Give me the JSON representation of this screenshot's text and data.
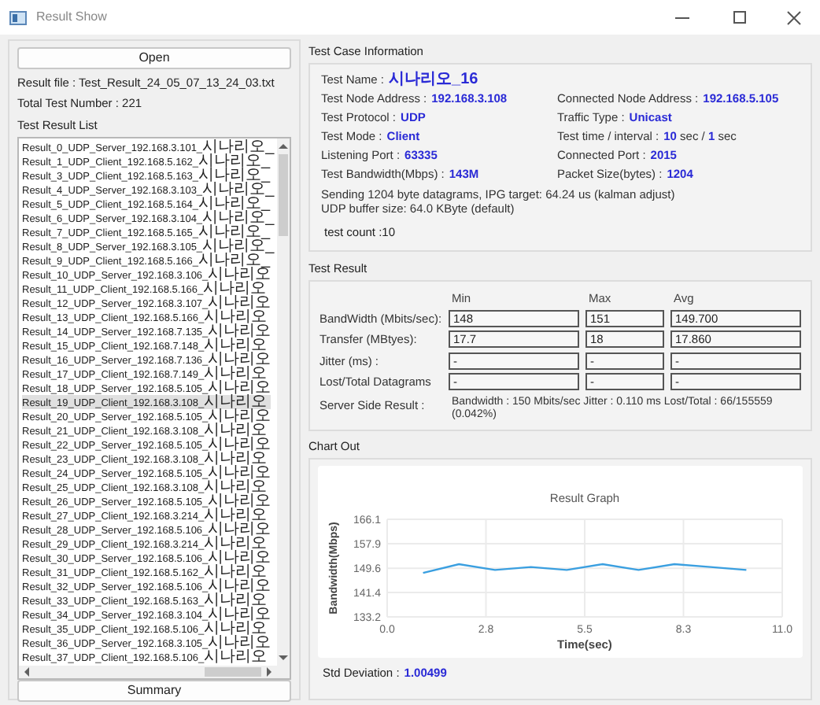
{
  "window": {
    "title": "Result Show"
  },
  "left_panel": {
    "open_button": "Open",
    "result_file": "Result file : Test_Result_24_05_07_13_24_03.txt",
    "total": "Total Test Number : 221",
    "list_title": "Test Result List",
    "items": [
      {
        "text": "Result_0_UDP_Server_192.168.3.101_시나리오_",
        "selected": false
      },
      {
        "text": "Result_1_UDP_Client_192.168.5.162_시나리오_",
        "selected": false
      },
      {
        "text": "Result_3_UDP_Client_192.168.5.163_시나리오_",
        "selected": false
      },
      {
        "text": "Result_4_UDP_Server_192.168.3.103_시나리오_",
        "selected": false
      },
      {
        "text": "Result_5_UDP_Client_192.168.5.164_시나리오_",
        "selected": false
      },
      {
        "text": "Result_6_UDP_Server_192.168.3.104_시나리오_",
        "selected": false
      },
      {
        "text": "Result_7_UDP_Client_192.168.5.165_시나리오_",
        "selected": false
      },
      {
        "text": "Result_8_UDP_Server_192.168.3.105_시나리오_",
        "selected": false
      },
      {
        "text": "Result_9_UDP_Client_192.168.5.166_시나리오_",
        "selected": false
      },
      {
        "text": "Result_10_UDP_Server_192.168.3.106_시나리오",
        "selected": false
      },
      {
        "text": "Result_11_UDP_Client_192.168.5.166_시나리오",
        "selected": false
      },
      {
        "text": "Result_12_UDP_Server_192.168.3.107_시나리오",
        "selected": false
      },
      {
        "text": "Result_13_UDP_Client_192.168.5.166_시나리오",
        "selected": false
      },
      {
        "text": "Result_14_UDP_Server_192.168.7.135_시나리오",
        "selected": false
      },
      {
        "text": "Result_15_UDP_Client_192.168.7.148_시나리오",
        "selected": false
      },
      {
        "text": "Result_16_UDP_Server_192.168.7.136_시나리오",
        "selected": false
      },
      {
        "text": "Result_17_UDP_Client_192.168.7.149_시나리오",
        "selected": false
      },
      {
        "text": "Result_18_UDP_Server_192.168.5.105_시나리오",
        "selected": false
      },
      {
        "text": "Result_19_UDP_Client_192.168.3.108_시나리오",
        "selected": true
      },
      {
        "text": "Result_20_UDP_Server_192.168.5.105_시나리오",
        "selected": false
      },
      {
        "text": "Result_21_UDP_Client_192.168.3.108_시나리오",
        "selected": false
      },
      {
        "text": "Result_22_UDP_Server_192.168.5.105_시나리오",
        "selected": false
      },
      {
        "text": "Result_23_UDP_Client_192.168.3.108_시나리오",
        "selected": false
      },
      {
        "text": "Result_24_UDP_Server_192.168.5.105_시나리오",
        "selected": false
      },
      {
        "text": "Result_25_UDP_Client_192.168.3.108_시나리오",
        "selected": false
      },
      {
        "text": "Result_26_UDP_Server_192.168.5.105_시나리오",
        "selected": false
      },
      {
        "text": "Result_27_UDP_Client_192.168.3.214_시나리오",
        "selected": false
      },
      {
        "text": "Result_28_UDP_Server_192.168.5.106_시나리오",
        "selected": false
      },
      {
        "text": "Result_29_UDP_Client_192.168.3.214_시나리오",
        "selected": false
      },
      {
        "text": "Result_30_UDP_Server_192.168.5.106_시나리오",
        "selected": false
      },
      {
        "text": "Result_31_UDP_Client_192.168.5.162_시나리오",
        "selected": false
      },
      {
        "text": "Result_32_UDP_Server_192.168.5.106_시나리오",
        "selected": false
      },
      {
        "text": "Result_33_UDP_Client_192.168.5.163_시나리오",
        "selected": false
      },
      {
        "text": "Result_34_UDP_Server_192.168.3.104_시나리오",
        "selected": false
      },
      {
        "text": "Result_35_UDP_Client_192.168.5.106_시나리오",
        "selected": false
      },
      {
        "text": "Result_36_UDP_Server_192.168.3.105_시나리오",
        "selected": false
      },
      {
        "text": "Result_37_UDP_Client_192.168.5.106_시나리오",
        "selected": false
      }
    ],
    "summary_button": "Summary"
  },
  "test_case_info": {
    "title": "Test Case Information",
    "rows": [
      [
        {
          "label": "Test Name :",
          "value": "시나리오_16",
          "kind": "plain"
        }
      ],
      [
        {
          "label": "Test Node Address :",
          "value": "192.168.3.108",
          "kind": "plain"
        },
        {
          "label": "Connected Node Address :",
          "value": "192.168.5.105",
          "kind": "plain"
        }
      ],
      [
        {
          "label": "Test Protocol :",
          "value": "UDP",
          "kind": "plain"
        },
        {
          "label": "Traffic Type :",
          "value": "Unicast",
          "kind": "plain"
        }
      ],
      [
        {
          "label": "Test Mode :",
          "value": "Client",
          "kind": "plain"
        },
        {
          "label": "Test time / interval :",
          "value": "**10** sec / **1** sec",
          "kind": "rich"
        }
      ],
      [
        {
          "label": "Listening Port :",
          "value": "63335",
          "kind": "plain"
        },
        {
          "label": "Connected Port :",
          "value": "2015",
          "kind": "plain"
        }
      ],
      [
        {
          "label": "Test Bandwidth(Mbps) :",
          "value": "143M",
          "kind": "plain"
        },
        {
          "label": "Packet Size(bytes) :",
          "value": "1204",
          "kind": "plain"
        }
      ]
    ],
    "notes": [
      "Sending 1204 byte datagrams, IPG target: 64.24 us (kalman adjust)",
      "UDP buffer size: 64.0 KByte (default)"
    ],
    "count": "test count :10"
  },
  "test_result": {
    "title": "Test Result",
    "columns": [
      "Min",
      "Max",
      "Avg"
    ],
    "rows": [
      {
        "label": "BandWidth (Mbits/sec):",
        "values": [
          "148",
          "151",
          "149.700"
        ]
      },
      {
        "label": "Transfer (MBtyes):",
        "values": [
          "17.7",
          "18",
          "17.860"
        ]
      },
      {
        "label": "Jitter (ms) :",
        "values": [
          "-",
          "-",
          "-"
        ]
      },
      {
        "label": "Lost/Total Datagrams",
        "values": [
          "-",
          "-",
          "-"
        ]
      }
    ],
    "server_side": {
      "label": "Server Side Result :",
      "value": "Bandwidth : 150 Mbits/sec Jitter : 0.110 ms Lost/Total : 66/155559 (0.042%)"
    }
  },
  "chart_out": {
    "title": "Chart Out",
    "chart_data": {
      "type": "line",
      "title": "Result Graph",
      "xlabel": "Time(sec)",
      "ylabel": "Bandwidth(Mbps)",
      "x": [
        1,
        2,
        3,
        4,
        5,
        6,
        7,
        8,
        9,
        10
      ],
      "grid": true,
      "series": [
        {
          "color": "#3a9fe0",
          "values": [
            148,
            151,
            149,
            150,
            149,
            151,
            149,
            151,
            150,
            149
          ]
        }
      ],
      "xlim": [
        0,
        11
      ],
      "ylim": [
        133.2,
        166.1
      ],
      "xticks": [
        {
          "value": 0,
          "label": "0.0"
        },
        {
          "value": 2.75,
          "label": "2.8"
        },
        {
          "value": 5.5,
          "label": "5.5"
        },
        {
          "value": 8.25,
          "label": "8.3"
        },
        {
          "value": 11,
          "label": "11.0"
        }
      ],
      "yticks": [
        {
          "value": 133.2,
          "label": "133.2"
        },
        {
          "value": 141.4,
          "label": "141.4"
        },
        {
          "value": 149.6,
          "label": "149.6"
        },
        {
          "value": 157.9,
          "label": "157.9"
        },
        {
          "value": 166.1,
          "label": "166.1"
        }
      ]
    },
    "std_label": "Std Deviation :",
    "std_value": "1.00499"
  }
}
